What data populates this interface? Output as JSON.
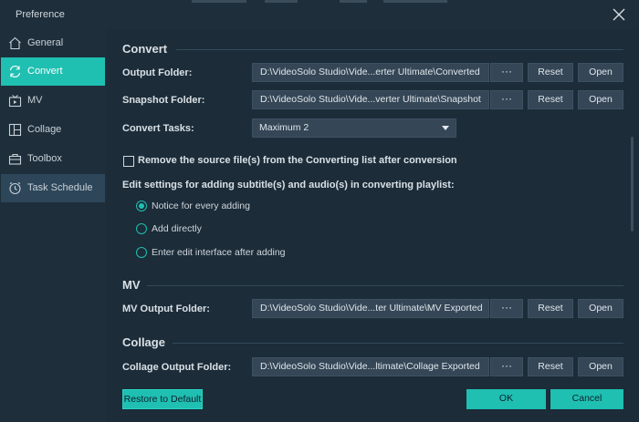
{
  "window": {
    "title": "Preference"
  },
  "sidebar": {
    "items": [
      {
        "label": "General",
        "icon": "home-icon"
      },
      {
        "label": "Convert",
        "icon": "convert-icon"
      },
      {
        "label": "MV",
        "icon": "mv-icon"
      },
      {
        "label": "Collage",
        "icon": "collage-icon"
      },
      {
        "label": "Toolbox",
        "icon": "toolbox-icon"
      },
      {
        "label": "Task Schedule",
        "icon": "clock-icon"
      }
    ],
    "active": "Convert",
    "hover": "Task Schedule"
  },
  "convert": {
    "title": "Convert",
    "output_folder": {
      "label": "Output Folder:",
      "path": "D:\\VideoSolo Studio\\Vide...erter Ultimate\\Converted"
    },
    "snapshot_folder": {
      "label": "Snapshot Folder:",
      "path": "D:\\VideoSolo Studio\\Vide...verter Ultimate\\Snapshot"
    },
    "tasks": {
      "label": "Convert Tasks:",
      "value": "Maximum 2"
    },
    "remove_source": {
      "label": "Remove the source file(s) from the Converting list after conversion",
      "checked": false
    },
    "edit_settings": {
      "label": "Edit settings for adding subtitle(s) and audio(s) in converting playlist:",
      "options": [
        "Notice for every adding",
        "Add directly",
        "Enter edit interface after adding"
      ],
      "selected": "Notice for every adding"
    }
  },
  "mv": {
    "title": "MV",
    "output_folder": {
      "label": "MV Output Folder:",
      "path": "D:\\VideoSolo Studio\\Vide...ter Ultimate\\MV Exported"
    }
  },
  "collage": {
    "title": "Collage",
    "output_folder": {
      "label": "Collage Output Folder:",
      "path": "D:\\VideoSolo Studio\\Vide...ltimate\\Collage Exported"
    }
  },
  "buttons": {
    "dots": "···",
    "reset": "Reset",
    "open": "Open",
    "restore": "Restore to Default",
    "ok": "OK",
    "cancel": "Cancel"
  },
  "colors": {
    "accent": "#1fbfb1",
    "background": "#1c2c39",
    "sidebar": "#1e2e3b",
    "field": "#354656"
  }
}
